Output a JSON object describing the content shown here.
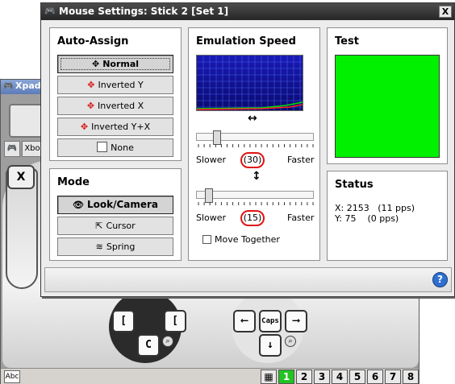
{
  "background_app": {
    "title": "Xpad",
    "tabs": [
      "",
      "Xbo"
    ],
    "x_button": "X",
    "dpad_keys": {
      "left": "[",
      "right": "[",
      "down": "C"
    },
    "right_keys": {
      "left": "⟵",
      "center": "Caps",
      "right": "⟶",
      "down": "↓"
    },
    "status_icon": "Abc",
    "sets": [
      "1",
      "2",
      "3",
      "4",
      "5",
      "6",
      "7",
      "8"
    ],
    "active_set": "1"
  },
  "dialog": {
    "title": "Mouse Settings: Stick 2 [Set 1]",
    "close_label": "X",
    "auto_assign": {
      "heading": "Auto-Assign",
      "buttons": [
        {
          "label": "Normal",
          "icon": "move-cross-icon",
          "pressed": true
        },
        {
          "label": "Inverted Y",
          "icon": "red-cross-y-icon",
          "pressed": false
        },
        {
          "label": "Inverted X",
          "icon": "red-cross-x-icon",
          "pressed": false
        },
        {
          "label": "Inverted Y+X",
          "icon": "red-cross-xy-icon",
          "pressed": false
        },
        {
          "label": "None",
          "icon": "checkbox-icon",
          "pressed": false
        }
      ]
    },
    "mode": {
      "heading": "Mode",
      "buttons": [
        {
          "label": "Look/Camera",
          "icon": "eye-icon",
          "pressed": true
        },
        {
          "label": "Cursor",
          "icon": "cursor-icon",
          "pressed": false
        },
        {
          "label": "Spring",
          "icon": "spring-icon",
          "pressed": false
        }
      ]
    },
    "emulation_speed": {
      "heading": "Emulation Speed",
      "horizontal": {
        "axis_icon": "↔",
        "value": 30,
        "value_text": "(30)",
        "min_label": "Slower",
        "max_label": "Faster"
      },
      "vertical": {
        "axis_icon": "↕",
        "value": 15,
        "value_text": "(15)",
        "min_label": "Slower",
        "max_label": "Faster"
      },
      "move_together_label": "Move Together",
      "move_together_checked": false
    },
    "test": {
      "heading": "Test",
      "box_color": "#00f000"
    },
    "status": {
      "heading": "Status",
      "x_line": "X: 2153   (11 pps)",
      "y_line": "Y: 75    (0 pps)"
    },
    "help_label": "?"
  }
}
